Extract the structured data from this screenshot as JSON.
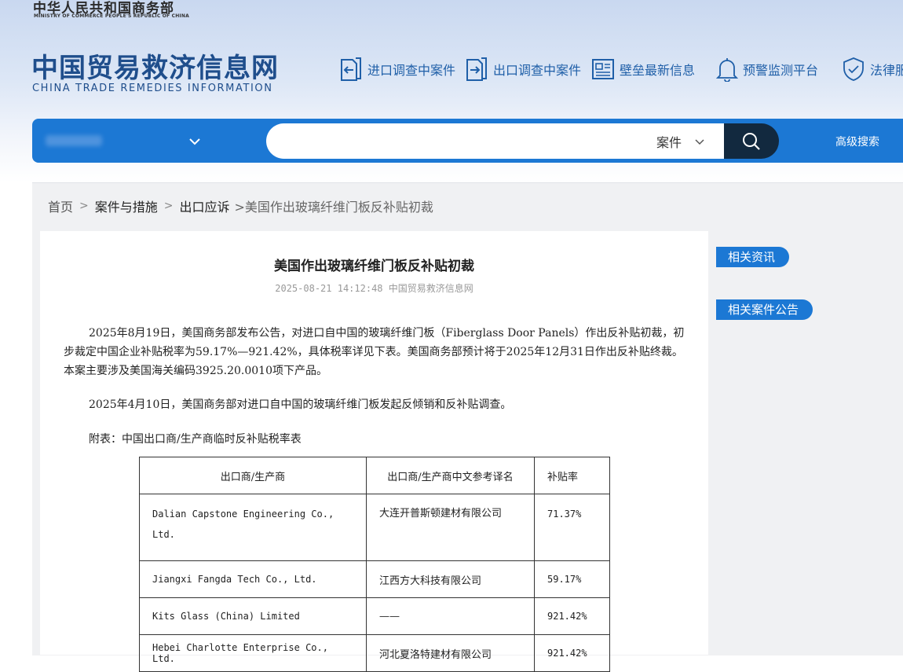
{
  "header": {
    "ministry_cn": "中华人民共和国商务部",
    "ministry_en": "MINISTRY OF COMMERCE PEOPLE'S REPUBLIC OF CHINA",
    "site_cn": "中国贸易救济信息网",
    "site_en": "CHINA TRADE REMEDIES INFORMATION",
    "nav": [
      {
        "label": "进口调查中案件",
        "icon": "import-doc-icon"
      },
      {
        "label": "出口调查中案件",
        "icon": "export-doc-icon"
      },
      {
        "label": "壁垒最新信息",
        "icon": "news-board-icon"
      },
      {
        "label": "预警监测平台",
        "icon": "bell-icon"
      },
      {
        "label": "法律服",
        "icon": "shield-check-icon"
      }
    ]
  },
  "search": {
    "region_value": "",
    "input_value": "",
    "type_value": "案件",
    "advanced_label": "高级搜索"
  },
  "breadcrumb": {
    "items": [
      "首页",
      "案件与措施",
      "出口应诉"
    ],
    "current": ">美国作出玻璃纤维门板反补贴初裁"
  },
  "article": {
    "title": "美国作出玻璃纤维门板反补贴初裁",
    "meta": "2025-08-21 14:12:48 中国贸易救济信息网",
    "paragraphs": [
      "2025年8月19日，美国商务部发布公告，对进口自中国的玻璃纤维门板（Fiberglass Door Panels）作出反补贴初裁，初步裁定中国企业补贴税率为59.17%—921.42%，具体税率详见下表。美国商务部预计将于2025年12月31日作出反补贴终裁。本案主要涉及美国海关编码3925.20.0010项下产品。",
      "2025年4月10日，美国商务部对进口自中国的玻璃纤维门板发起反倾销和反补贴调查。",
      "附表：中国出口商/生产商临时反补贴税率表"
    ],
    "table": {
      "headers": [
        "出口商/生产商",
        "出口商/生产商中文参考译名",
        "补贴率"
      ],
      "rows": [
        [
          "Dalian Capstone Engineering Co., Ltd.",
          "大连开普斯顿建材有限公司",
          "71.37%"
        ],
        [
          "Jiangxi Fangda Tech Co., Ltd.",
          "江西方大科技有限公司",
          "59.17%"
        ],
        [
          "Kits Glass (China) Limited",
          "——",
          "921.42%"
        ],
        [
          "Hebei Charlotte Enterprise Co., Ltd.",
          "河北夏洛特建材有限公司",
          "921.42%"
        ]
      ]
    }
  },
  "sidebar": {
    "related_news": "相关资讯",
    "related_cases": "相关案件公告"
  },
  "colors": {
    "brand_blue": "#1c78d4",
    "dark_navy": "#12293f",
    "title_blue": "#1f4e8c"
  }
}
